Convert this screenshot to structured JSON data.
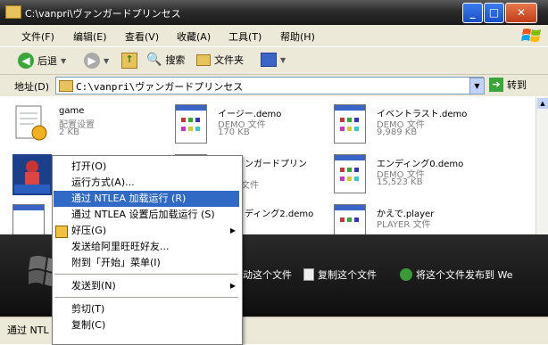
{
  "window": {
    "title": "C:\\vanpri\\ヴァンガードプリンセス",
    "controls": [
      "_",
      "□",
      "✕"
    ]
  },
  "menubar": {
    "items": [
      "文件(F)",
      "编辑(E)",
      "查看(V)",
      "收藏(A)",
      "工具(T)",
      "帮助(H)"
    ]
  },
  "toolbar": {
    "back": "后退",
    "search": "搜索",
    "folders": "文件夹"
  },
  "address": {
    "label": "地址(D)",
    "value": "C:\\vanpri\\ヴァンガードプリンセス",
    "go": "转到"
  },
  "files": [
    {
      "name": "game",
      "type": "配置设置",
      "size": "2 KB"
    },
    {
      "name": "イージー.demo",
      "type": "DEMO 文件",
      "size": "170 KB"
    },
    {
      "name": "イベントラスト.demo",
      "type": "DEMO 文件",
      "size": "9,989 KB"
    },
    {
      "name": "ンガードプリン",
      "type": "文件",
      "size": ""
    },
    {
      "name": "エンディング0.demo",
      "type": "DEMO 文件",
      "size": "15,523 KB"
    },
    {
      "name": "ディング2.demo",
      "type": "",
      "size": ""
    },
    {
      "name": "かえで.player",
      "type": "PLAYER 文件",
      "size": ""
    }
  ],
  "taskbar": {
    "links": [
      "动这个文件",
      "复制这个文件",
      "将这个文件发布到 We"
    ]
  },
  "status": {
    "text": "通过 NTL"
  },
  "context_menu": {
    "items": [
      {
        "label": "打开(O)"
      },
      {
        "label": "运行方式(A)..."
      },
      {
        "label": "通过 NTLEA 加载运行 (R)",
        "highlighted": true
      },
      {
        "label": "通过 NTLEA 设置后加载运行 (S)"
      },
      {
        "label": "好压(G)",
        "submenu": true
      },
      {
        "label": "发送给阿里旺旺好友..."
      },
      {
        "label": "附到「开始」菜单(I)"
      },
      {
        "label": "发送到(N)",
        "submenu": true
      },
      {
        "label": "剪切(T)"
      },
      {
        "label": "复制(C)"
      }
    ]
  },
  "colors": {
    "highlight": "#316ac5",
    "xp_chrome": "#ece9d8"
  }
}
